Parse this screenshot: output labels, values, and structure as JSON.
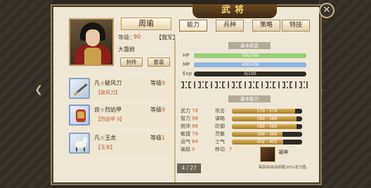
{
  "title": "武将",
  "general": {
    "name": "周瑜",
    "level_label": "等级：",
    "level": "90",
    "army_tag": "【我军】",
    "rank": "大督尉",
    "bio_button": "列传",
    "set_button": "套装"
  },
  "tabs": [
    {
      "label": "能力",
      "active": true
    },
    {
      "label": "兵种",
      "active": false
    },
    {
      "label": "策略",
      "active": false
    },
    {
      "label": "特技",
      "active": false
    }
  ],
  "sections": {
    "basic_status": "基本状态",
    "basic_ability": "基本能力"
  },
  "bars": [
    {
      "label": "HP",
      "text": "790/790",
      "fraction": 1.0,
      "color": "#9bcf7a"
    },
    {
      "label": "MP",
      "text": "406/406",
      "fraction": 1.0,
      "color": "#8fb4dc"
    },
    {
      "label": "Exp",
      "text": "0/100",
      "fraction": 0.0,
      "color": "#cfc2a8"
    }
  ],
  "attributes": [
    {
      "name": "武力",
      "value": "78"
    },
    {
      "name": "智力",
      "value": "98"
    },
    {
      "name": "统帅",
      "value": "98"
    },
    {
      "name": "敏捷",
      "value": "78"
    },
    {
      "name": "运气",
      "value": "84"
    },
    {
      "name": "破敌",
      "value": "0"
    }
  ],
  "combat_stats": [
    {
      "name": "攻击",
      "text": "579 - 579",
      "fraction": 0.9
    },
    {
      "name": "谋略",
      "text": "589 - 589",
      "fraction": 0.92
    },
    {
      "name": "防御",
      "text": "589 - 589",
      "fraction": 0.92
    },
    {
      "name": "灵敏",
      "text": "399 - 399",
      "fraction": 0.72
    },
    {
      "name": "士气",
      "text": "402 - 402",
      "fraction": 0.73
    }
  ],
  "move": {
    "label": "移动",
    "value": "7"
  },
  "equipment": [
    {
      "name": "凡☆破风刀",
      "sub": "【破风刀】",
      "level_label": "等级",
      "level": "9",
      "border": "#8aa4c2"
    },
    {
      "name": "良☆烈焰甲",
      "sub": "【烈焰甲 II】",
      "level_label": "等级",
      "level": "9",
      "border": "#7a9ad0"
    },
    {
      "name": "凡☆玉龙",
      "sub": "【玉龙】",
      "level_label": "等级",
      "level": "1",
      "border": "#8aa4c2"
    }
  ],
  "page_indicator": "4 / 27",
  "skill": {
    "name": "凝神",
    "description": "每回合自动回复10%法力值。"
  },
  "icons": {
    "close": "close-icon",
    "left_arrow": "chevron-left-icon",
    "right_arrow": "chevron-right-icon"
  }
}
